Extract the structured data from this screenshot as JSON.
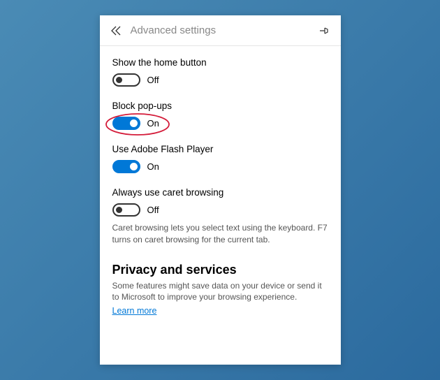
{
  "header": {
    "title": "Advanced settings"
  },
  "settings": {
    "home_button": {
      "label": "Show the home button",
      "state": "Off"
    },
    "block_popups": {
      "label": "Block pop-ups",
      "state": "On"
    },
    "flash": {
      "label": "Use Adobe Flash Player",
      "state": "On"
    },
    "caret": {
      "label": "Always use caret browsing",
      "state": "Off",
      "description": "Caret browsing lets you select text using the keyboard. F7 turns on caret browsing for the current tab."
    }
  },
  "privacy": {
    "heading": "Privacy and services",
    "description": "Some features might save data on your device or send it to Microsoft to improve your browsing experience.",
    "link": "Learn more"
  },
  "colors": {
    "accent": "#0078d7",
    "annotation": "#d41c3a"
  }
}
